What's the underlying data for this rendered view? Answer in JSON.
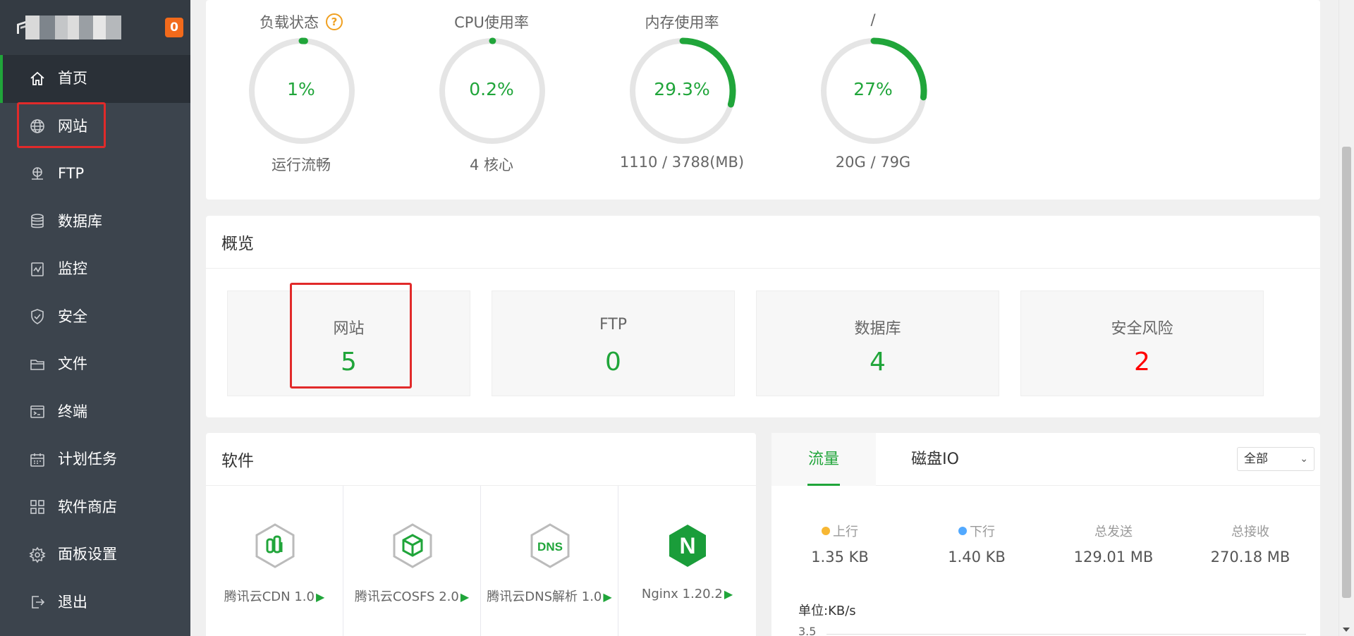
{
  "brand": {
    "notification_count": "0",
    "logo_icon": "panel-logo-icon"
  },
  "sidebar": {
    "items": [
      {
        "label": "首页",
        "icon": "home-icon",
        "active": true
      },
      {
        "label": "网站",
        "icon": "globe-icon",
        "highlighted": true
      },
      {
        "label": "FTP",
        "icon": "ftp-icon"
      },
      {
        "label": "数据库",
        "icon": "database-icon"
      },
      {
        "label": "监控",
        "icon": "monitor-icon"
      },
      {
        "label": "安全",
        "icon": "shield-icon"
      },
      {
        "label": "文件",
        "icon": "folder-icon"
      },
      {
        "label": "终端",
        "icon": "terminal-icon"
      },
      {
        "label": "计划任务",
        "icon": "calendar-icon"
      },
      {
        "label": "软件商店",
        "icon": "grid-icon"
      },
      {
        "label": "面板设置",
        "icon": "gear-icon"
      },
      {
        "label": "退出",
        "icon": "logout-icon"
      }
    ]
  },
  "status": {
    "gauges": [
      {
        "title": "负载状态",
        "value": "1%",
        "percent": 1,
        "sub": "运行流畅",
        "help_icon": "?"
      },
      {
        "title": "CPU使用率",
        "value": "0.2%",
        "percent": 0.2,
        "sub": "4 核心"
      },
      {
        "title": "内存使用率",
        "value": "29.3%",
        "percent": 29.3,
        "sub": "1110 / 3788(MB)"
      },
      {
        "title": "/",
        "value": "27%",
        "percent": 27,
        "sub": "20G / 79G"
      }
    ]
  },
  "overview": {
    "title": "概览",
    "cards": [
      {
        "label": "网站",
        "value": "5",
        "highlighted": true
      },
      {
        "label": "FTP",
        "value": "0"
      },
      {
        "label": "数据库",
        "value": "4"
      },
      {
        "label": "安全风险",
        "value": "2",
        "danger": true
      }
    ]
  },
  "software": {
    "title": "软件",
    "items": [
      {
        "name": "腾讯云CDN 1.0",
        "icon": "tencent-cdn-icon"
      },
      {
        "name": "腾讯云COSFS 2.0",
        "icon": "tencent-cosfs-icon"
      },
      {
        "name": "腾讯云DNS解析 1.0",
        "icon": "tencent-dns-icon",
        "icon_text": "DNS"
      },
      {
        "name": "Nginx 1.20.2",
        "icon": "nginx-icon",
        "icon_text": "N"
      }
    ],
    "play_glyph": "▶"
  },
  "traffic": {
    "tabs": [
      {
        "label": "流量",
        "active": true
      },
      {
        "label": "磁盘IO"
      }
    ],
    "select": {
      "value": "全部",
      "chevron": "⌄"
    },
    "stats": [
      {
        "label": "上行",
        "value": "1.35 KB",
        "dot_color": "#f7b733"
      },
      {
        "label": "下行",
        "value": "1.40 KB",
        "dot_color": "#52a9ff"
      },
      {
        "label": "总发送",
        "value": "129.01 MB"
      },
      {
        "label": "总接收",
        "value": "270.18 MB"
      }
    ],
    "unit_label": "单位:KB/s",
    "axis_top_tick": "3.5"
  },
  "colors": {
    "accent": "#20a53a",
    "sidebar_bg": "#3c444d",
    "danger": "#ff0000",
    "highlight_box": "#e12a2a",
    "badge": "#f26a1b"
  }
}
